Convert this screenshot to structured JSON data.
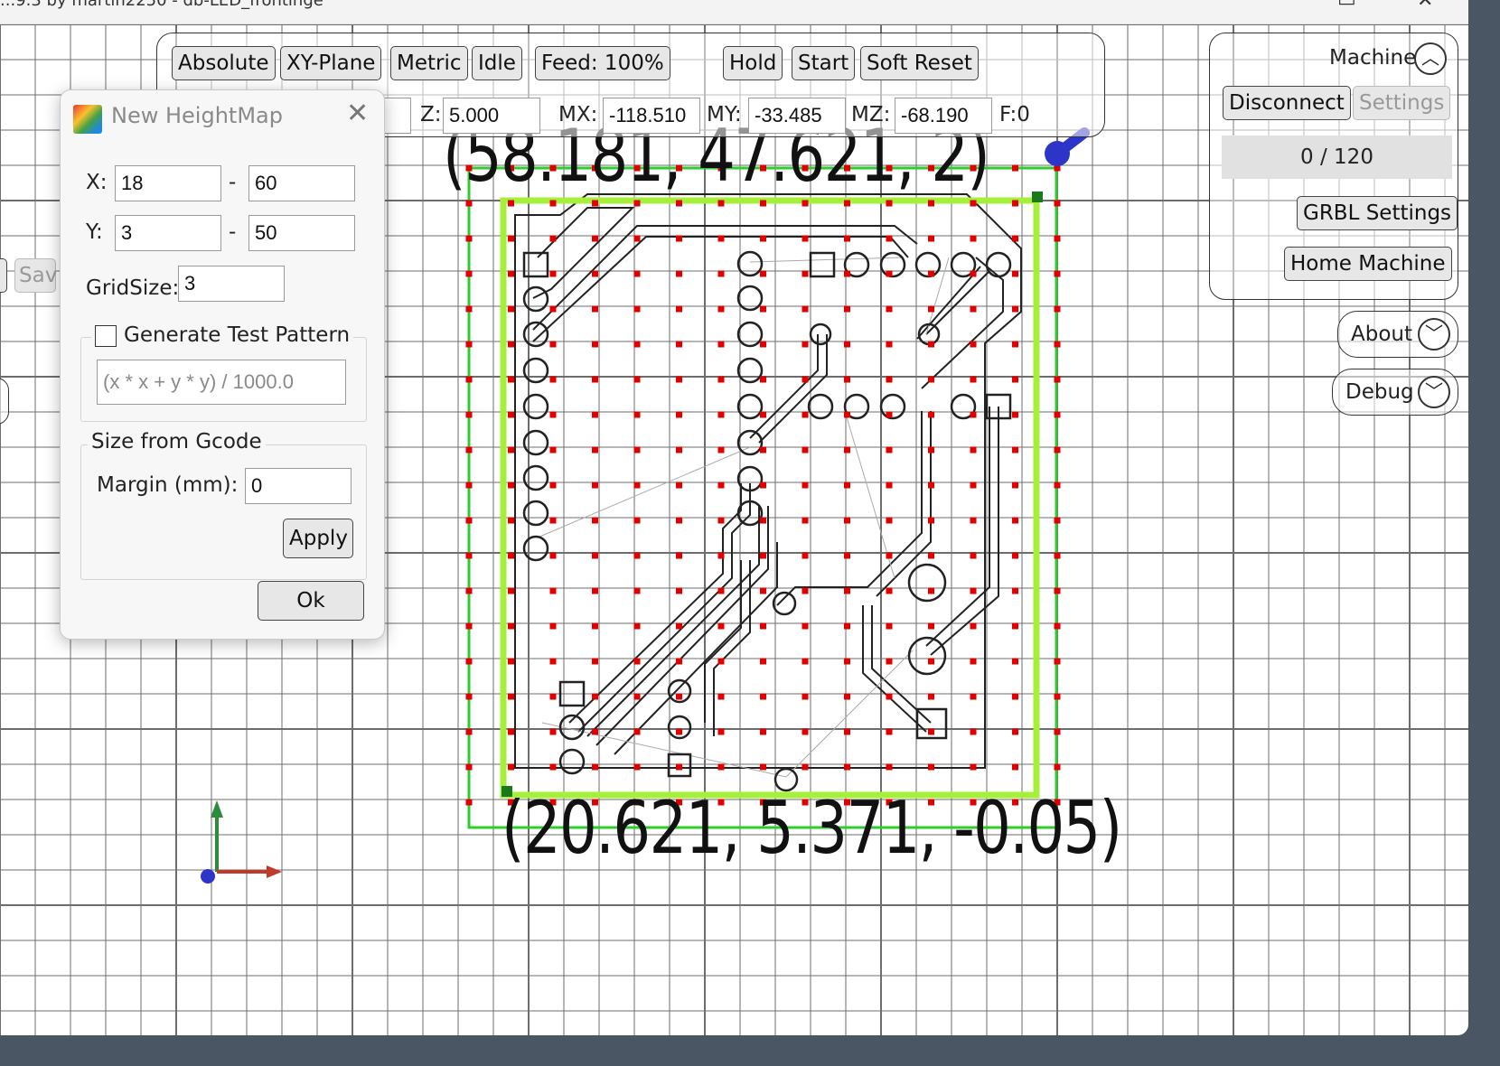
{
  "window": {
    "title": "...9.3 by martin2250 - db-LED_frontinge",
    "minimize_glyph": "▭",
    "close_glyph": "✕"
  },
  "toolbar": {
    "distance_mode": "Absolute",
    "plane": "XY-Plane",
    "units": "Metric",
    "status": "Idle",
    "feed": "Feed: 100%",
    "hold": "Hold",
    "start": "Start",
    "soft_reset": "Soft Reset"
  },
  "position": {
    "z_label": "Z:",
    "z_value": "5.000",
    "mx_label": "MX:",
    "mx_value": "-118.510",
    "my_label": "MY:",
    "my_value": "-33.485",
    "mz_label": "MZ:",
    "mz_value": "-68.190",
    "f_label": "F:0"
  },
  "left_panel": {
    "save_label": "Sav"
  },
  "machine_panel": {
    "title": "Machine",
    "disconnect": "Disconnect",
    "settings": "Settings",
    "progress_text": "0 / 120",
    "progress_fraction": 0,
    "grbl_settings": "GRBL Settings",
    "home_machine": "Home Machine"
  },
  "about": {
    "label": "About"
  },
  "debug": {
    "label": "Debug"
  },
  "dialog": {
    "title": "New HeightMap",
    "x_label": "X:",
    "x_min": "18",
    "x_max": "60",
    "y_label": "Y:",
    "y_min": "3",
    "y_max": "50",
    "dash": "-",
    "gridsize_label": "GridSize:",
    "gridsize": "3",
    "test_pattern_label": "Generate Test Pattern",
    "test_pattern_checked": false,
    "test_pattern_placeholder": "(x * x + y * y) / 1000.0",
    "size_from_gcode_label": "Size from Gcode",
    "margin_label": "Margin (mm):",
    "margin": "0",
    "apply": "Apply",
    "ok": "Ok"
  },
  "viewport": {
    "top_coord": "(58.181, 47.621, 2)",
    "bottom_coord": "(20.621, 5.371, -0.05)",
    "colors": {
      "grid": "#6d6d6d",
      "heightmap_bounds": "#2ecc2e",
      "gcode_bounds": "#a6f03a",
      "probe_points": "#e00000",
      "tool_marker": "#2d35c8",
      "x_axis": "#c0392b",
      "y_axis": "#2e8b3d"
    }
  }
}
